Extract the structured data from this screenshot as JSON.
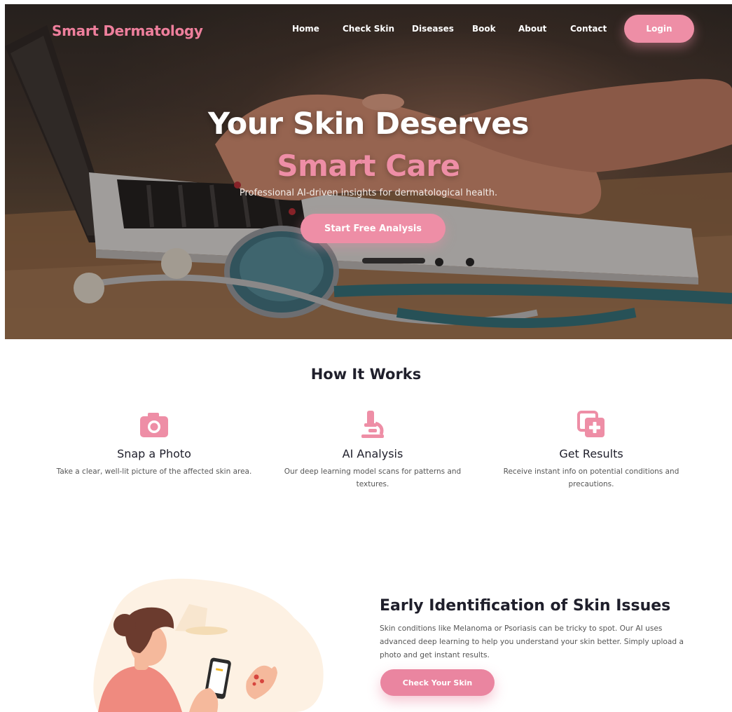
{
  "nav": {
    "brand": "Smart Dermatology",
    "links": [
      "Home",
      "Check Skin",
      "Diseases",
      "Book",
      "About",
      "Contact"
    ],
    "login_label": "Login"
  },
  "hero": {
    "title": "Your Skin Deserves",
    "title_accent": "Smart Care",
    "subtitle": "Professional AI-driven insights for dermatological health.",
    "cta_label": "Start Free Analysis"
  },
  "how": {
    "title": "How It Works",
    "steps": [
      {
        "icon": "camera-icon",
        "title": "Snap a Photo",
        "desc": "Take a clear, well-lit picture of the affected skin area."
      },
      {
        "icon": "microscope-icon",
        "title": "AI Analysis",
        "desc": "Our deep learning model scans for patterns and textures."
      },
      {
        "icon": "medical-copy-icon",
        "title": "Get Results",
        "desc": "Receive instant info on potential conditions and precautions."
      }
    ]
  },
  "early": {
    "title": "Early Identification of Skin Issues",
    "desc": "Skin conditions like Melanoma or Psoriasis can be tricky to spot. Our AI uses advanced deep learning to help you understand your skin better. Simply upload a photo and get instant results.",
    "cta_label": "Check Your Skin"
  },
  "colors": {
    "accent": "#ee8ea6",
    "brand": "#ee7f9c",
    "heading": "#1f1f2b"
  }
}
